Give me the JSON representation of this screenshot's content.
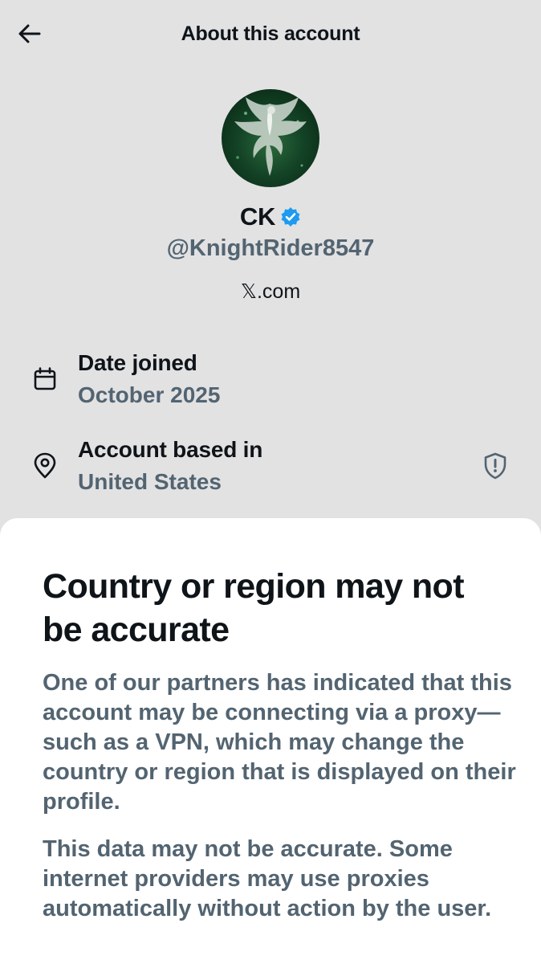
{
  "header": {
    "title": "About this account",
    "back_icon": "arrow-left-icon"
  },
  "profile": {
    "avatar_icon": "phoenix-avatar",
    "name": "CK",
    "verified_icon": "verified-badge-icon",
    "verified_color": "#1d9bf0",
    "handle": "@KnightRider8547",
    "site": "𝕏.com"
  },
  "details": {
    "date_joined": {
      "icon": "calendar-icon",
      "title": "Date joined",
      "value": "October 2025"
    },
    "location": {
      "icon": "location-pin-icon",
      "title": "Account based in",
      "value": "United States",
      "action_icon": "shield-warning-icon"
    }
  },
  "sheet": {
    "title": "Country or region may not be accurate",
    "paragraphs": [
      "One of our partners has indicated that this account may be connecting via a proxy—such as a VPN, which may change the country or region that is displayed on their profile.",
      "This data may not be accurate. Some internet providers may use proxies automatically without action by the user."
    ]
  },
  "colors": {
    "background": "#e2e2e3",
    "sheet": "#ffffff",
    "primary_text": "#0f1419",
    "secondary_text": "#536471"
  }
}
